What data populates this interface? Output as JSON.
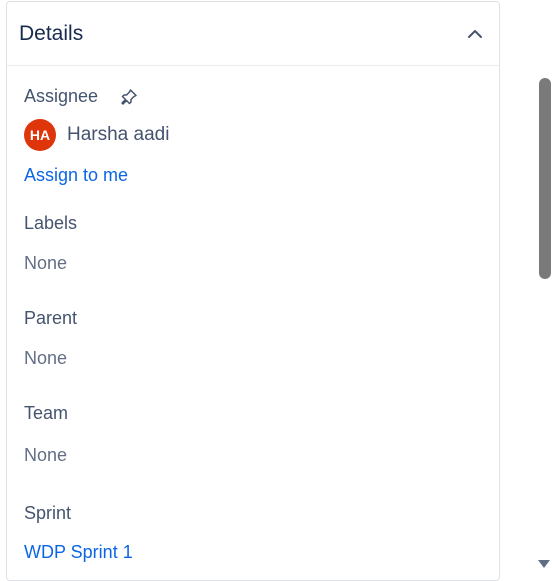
{
  "panel": {
    "title": "Details"
  },
  "assignee": {
    "label": "Assignee",
    "avatar_initials": "HA",
    "avatar_color": "#de350b",
    "name": "Harsha aadi",
    "assign_to_me": "Assign to me"
  },
  "labels": {
    "label": "Labels",
    "value": "None"
  },
  "parent": {
    "label": "Parent",
    "value": "None"
  },
  "team": {
    "label": "Team",
    "value": "None"
  },
  "sprint": {
    "label": "Sprint",
    "value": "WDP Sprint 1"
  },
  "colors": {
    "link": "#0c66e4",
    "text": "#44546f",
    "muted": "#626f86"
  }
}
